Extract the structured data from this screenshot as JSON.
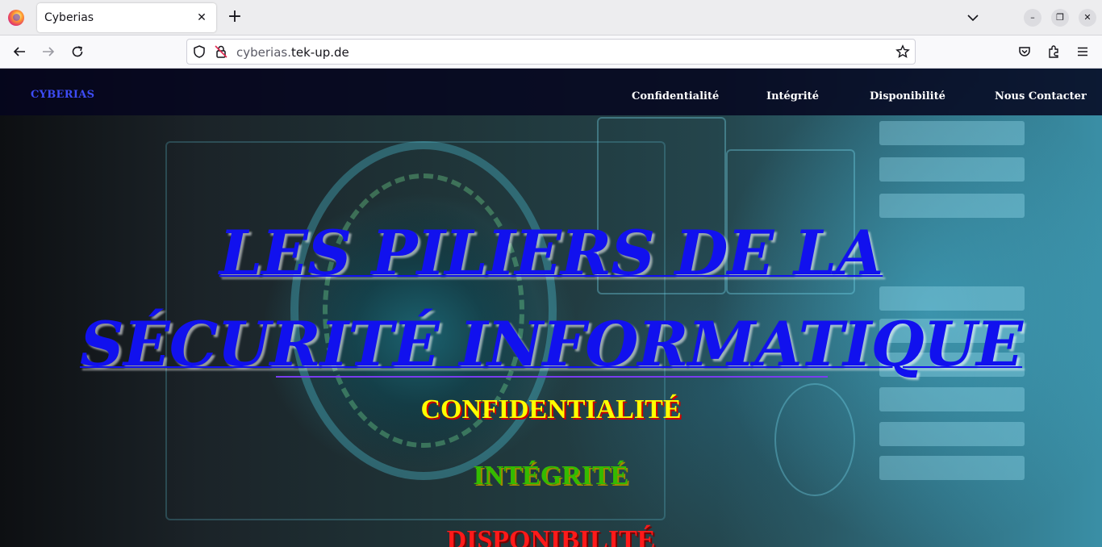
{
  "browser": {
    "tab_title": "Cyberias",
    "tab_close_glyph": "✕",
    "new_tab_glyph": "+",
    "url_prefix": "cyberias.",
    "url_domain": "tek-up.de",
    "window_minimize_glyph": "–",
    "window_restore_glyph": "❐",
    "window_close_glyph": "✕",
    "icons": [
      "firefox-icon",
      "back-icon",
      "forward-icon",
      "reload-icon",
      "shield-icon",
      "insecure-lock-icon",
      "bookmark-star-icon",
      "pocket-icon",
      "extensions-icon",
      "menu-icon",
      "tab-list-icon"
    ]
  },
  "site": {
    "brand": "CYBERIAS",
    "nav": [
      {
        "label": "Confidentialité"
      },
      {
        "label": "Intégrité"
      },
      {
        "label": "Disponibilité"
      },
      {
        "label": "Nous Contacter"
      }
    ],
    "hero": {
      "title": "LES PILIERS DE LA SÉCURITÉ INFORMATIQUE",
      "pillars": [
        "CONFIDENTIALITÉ",
        "INTÉGRITÉ",
        "DISPONIBILITÉ"
      ]
    }
  },
  "colors": {
    "title": "#1111ee",
    "brand": "#3d4cf5",
    "pillar_1": "#ffff00",
    "pillar_2": "#33bb00",
    "pillar_3": "#ff1a1a",
    "header_bg": "#05051e"
  }
}
